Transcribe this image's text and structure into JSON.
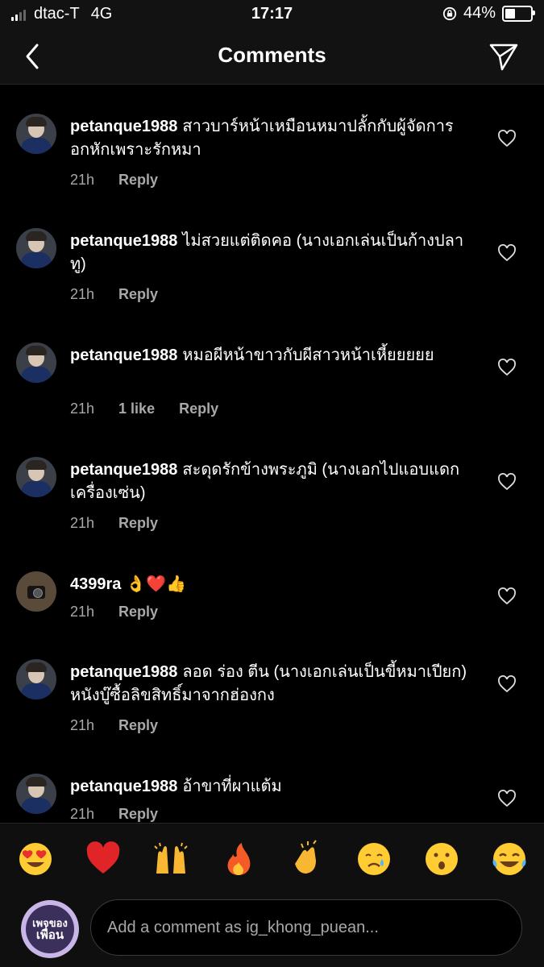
{
  "status_bar": {
    "carrier": "dtac-T",
    "network": "4G",
    "time": "17:17",
    "battery_percent": "44%",
    "battery_level": 0.44
  },
  "header": {
    "title": "Comments"
  },
  "comments": [
    {
      "username": "petanque1988",
      "text": "สาวบาร์หน้าเหมือนหมาปลั้กกับผู้จัดการอกหักเพราะรักหมา",
      "time": "21h",
      "likes": "",
      "reply": "Reply"
    },
    {
      "username": "petanque1988",
      "text": "ไม่สวยแต่ติดคอ (นางเอกเล่นเป็นก้างปลาทู)",
      "time": "21h",
      "likes": "",
      "reply": "Reply"
    },
    {
      "username": "petanque1988",
      "text": "หมอผีหน้าขาวกับผีสาวหน้าเหี้ยยยยย",
      "time": "21h",
      "likes": "1 like",
      "reply": "Reply"
    },
    {
      "username": "petanque1988",
      "text": "สะดุดรักข้างพระภูมิ (นางเอกไปแอบแดกเครื่องเซ่น)",
      "time": "21h",
      "likes": "",
      "reply": "Reply"
    },
    {
      "username": "4399ra",
      "text": "👌❤️👍",
      "time": "21h",
      "likes": "",
      "reply": "Reply"
    },
    {
      "username": "petanque1988",
      "text": "ลอด ร่อง ตีน (นางเอกเล่นเป็นขี้หมาเปียก) หนังบู๊ซื้อลิขสิทธิ์มาจากฮ่องกง",
      "time": "21h",
      "likes": "",
      "reply": "Reply"
    },
    {
      "username": "petanque1988",
      "text": "อ้าขาที่ผาแต้ม",
      "time": "21h",
      "likes": "",
      "reply": "Reply"
    }
  ],
  "emoji_bar": [
    "😍",
    "❤️",
    "🙌",
    "🔥",
    "👏",
    "😢",
    "😮",
    "😂"
  ],
  "composer": {
    "avatar_text_1": "เพจของ",
    "avatar_text_2": "เพื่อน",
    "placeholder": "Add a comment as ig_khong_puean..."
  }
}
